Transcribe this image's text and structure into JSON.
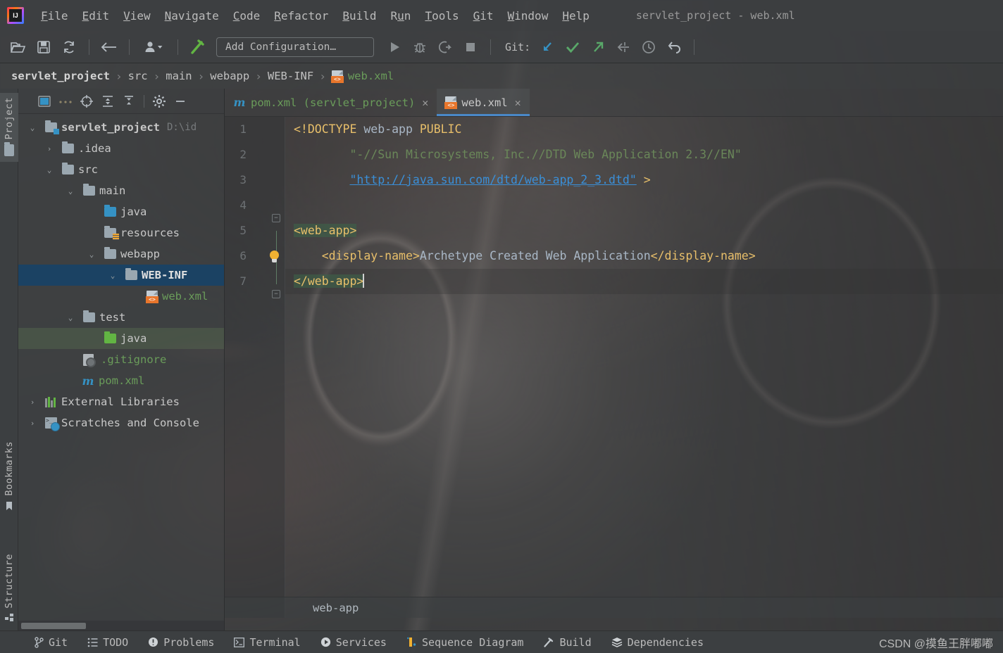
{
  "window": {
    "title": "servlet_project - web.xml",
    "logo_icon": "intellij-idea-logo"
  },
  "menubar": {
    "items": [
      {
        "label": "File",
        "mnemonic": "F",
        "rest": "ile"
      },
      {
        "label": "Edit",
        "mnemonic": "E",
        "rest": "dit"
      },
      {
        "label": "View",
        "mnemonic": "V",
        "rest": "iew"
      },
      {
        "label": "Navigate",
        "mnemonic": "N",
        "rest": "avigate"
      },
      {
        "label": "Code",
        "mnemonic": "C",
        "rest": "ode"
      },
      {
        "label": "Refactor",
        "mnemonic": "R",
        "rest": "efactor"
      },
      {
        "label": "Build",
        "mnemonic": "B",
        "rest": "uild"
      },
      {
        "label": "Run",
        "mnemonic": "R",
        "rest": "un"
      },
      {
        "label": "Tools",
        "mnemonic": "T",
        "rest": "ools"
      },
      {
        "label": "Git",
        "mnemonic": "G",
        "rest": "it"
      },
      {
        "label": "Window",
        "mnemonic": "W",
        "rest": "indow"
      },
      {
        "label": "Help",
        "mnemonic": "H",
        "rest": "elp"
      }
    ]
  },
  "toolbar": {
    "icons": [
      "open-folder-icon",
      "save-all-icon",
      "sync-refresh-icon",
      "back-arrow-icon",
      "user-profile-icon",
      "build-hammer-icon"
    ],
    "run_configuration": "Add Configuration…",
    "run_icon": "run-play-icon",
    "debug_icon": "debug-bug-icon",
    "run_coverage_icon": "run-with-coverage-icon",
    "stop_icon": "stop-square-icon",
    "git_label": "Git:",
    "git_icons": [
      "git-update-project-icon",
      "git-commit-check-icon",
      "git-push-icon",
      "git-rebase-icon",
      "git-history-clock-icon",
      "git-rollback-undo-icon"
    ]
  },
  "breadcrumb": {
    "items": [
      {
        "label": "servlet_project",
        "style": "bold"
      },
      {
        "label": "src",
        "style": "plain"
      },
      {
        "label": "main",
        "style": "plain"
      },
      {
        "label": "webapp",
        "style": "plain"
      },
      {
        "label": "WEB-INF",
        "style": "plain"
      },
      {
        "label": "web.xml",
        "style": "file",
        "icon": "xml-file-icon"
      }
    ],
    "separator": "›"
  },
  "rail": {
    "items": [
      {
        "label": "Project",
        "icon": "project-folder-icon",
        "active": true
      },
      {
        "label": "Bookmarks",
        "icon": "bookmark-flag-icon",
        "active": false
      },
      {
        "label": "Structure",
        "icon": "structure-grid-icon",
        "active": false
      }
    ]
  },
  "project_panel": {
    "toolbar_icons": [
      "select-opened-file-icon",
      "more-options-icon",
      "locate-target-icon",
      "expand-all-icon",
      "collapse-all-icon",
      "settings-gear-icon",
      "hide-minus-icon"
    ],
    "tree": [
      {
        "label": "servlet_project",
        "path": "D:\\id",
        "icon": "module-folder-icon",
        "twist": "⌄",
        "indent": 0,
        "color": "plain",
        "row": "none"
      },
      {
        "label": ".idea",
        "path": "",
        "icon": "folder-icon",
        "twist": "›",
        "indent": 1,
        "color": "plain",
        "row": "none"
      },
      {
        "label": "src",
        "path": "",
        "icon": "folder-icon",
        "twist": "⌄",
        "indent": 1,
        "color": "plain",
        "row": "none"
      },
      {
        "label": "main",
        "path": "",
        "icon": "folder-icon",
        "twist": "⌄",
        "indent": 2,
        "color": "plain",
        "row": "none"
      },
      {
        "label": "java",
        "path": "",
        "icon": "sources-root-folder-icon",
        "twist": "",
        "indent": 3,
        "color": "plain",
        "row": "none"
      },
      {
        "label": "resources",
        "path": "",
        "icon": "resources-root-folder-icon",
        "twist": "",
        "indent": 3,
        "color": "plain",
        "row": "none"
      },
      {
        "label": "webapp",
        "path": "",
        "icon": "folder-icon",
        "twist": "⌄",
        "indent": 3,
        "color": "plain",
        "row": "none"
      },
      {
        "label": "WEB-INF",
        "path": "",
        "icon": "folder-icon",
        "twist": "⌄",
        "indent": 4,
        "color": "plain",
        "row": "selected"
      },
      {
        "label": "web.xml",
        "path": "",
        "icon": "xml-file-icon",
        "twist": "",
        "indent": 5,
        "color": "green",
        "row": "none"
      },
      {
        "label": "test",
        "path": "",
        "icon": "folder-icon",
        "twist": "⌄",
        "indent": 2,
        "color": "plain",
        "row": "none"
      },
      {
        "label": "java",
        "path": "",
        "icon": "test-sources-root-folder-icon",
        "twist": "",
        "indent": 3,
        "color": "plain",
        "row": "highlight"
      },
      {
        "label": ".gitignore",
        "path": "",
        "icon": "gitignore-file-icon",
        "twist": "",
        "indent": 2,
        "color": "green",
        "row": "none"
      },
      {
        "label": "pom.xml",
        "path": "",
        "icon": "maven-pom-icon",
        "twist": "",
        "indent": 2,
        "color": "green",
        "row": "none"
      },
      {
        "label": "External Libraries",
        "path": "",
        "icon": "external-libraries-icon",
        "twist": "›",
        "indent": 0,
        "color": "plain",
        "row": "none"
      },
      {
        "label": "Scratches and Console",
        "path": "",
        "icon": "scratches-console-icon",
        "twist": "›",
        "indent": 0,
        "color": "plain",
        "row": "none"
      }
    ]
  },
  "editor": {
    "tabs": [
      {
        "label": "pom.xml (servlet_project)",
        "icon": "maven-pom-icon",
        "active": false,
        "close": "✕"
      },
      {
        "label": "web.xml",
        "icon": "xml-file-icon",
        "active": true,
        "close": "✕"
      }
    ],
    "line_numbers": [
      "1",
      "2",
      "3",
      "4",
      "5",
      "6",
      "7"
    ],
    "lines": [
      {
        "n": "1",
        "segments": [
          {
            "t": "<!DOCTYPE ",
            "c": "tag"
          },
          {
            "t": "web-app",
            "c": "txt"
          },
          {
            "t": " PUBLIC",
            "c": "tag"
          }
        ]
      },
      {
        "n": "2",
        "segments": [
          {
            "t": "        \"-//Sun Microsystems, Inc.//DTD Web Application 2.3//EN\"",
            "c": "str"
          }
        ]
      },
      {
        "n": "3",
        "segments": [
          {
            "t": "        ",
            "c": "txt"
          },
          {
            "t": "\"http://java.sun.com/dtd/web-app_2_3.dtd\"",
            "c": "url"
          },
          {
            "t": " >",
            "c": "tag"
          }
        ]
      },
      {
        "n": "4",
        "segments": []
      },
      {
        "n": "5",
        "segments": [
          {
            "t": "<web-app>",
            "c": "tag",
            "hl": true
          }
        ]
      },
      {
        "n": "6",
        "segments": [
          {
            "t": "    ",
            "c": "txt"
          },
          {
            "t": "<display-name>",
            "c": "tag"
          },
          {
            "t": "Archetype Created Web Application",
            "c": "txt"
          },
          {
            "t": "</display-name>",
            "c": "tag"
          }
        ]
      },
      {
        "n": "7",
        "segments": [
          {
            "t": "</web-app>",
            "c": "tag",
            "hl": true,
            "caret": true
          }
        ]
      }
    ],
    "footer_breadcrumb": "web-app",
    "bulb_icon": "intention-lightbulb-icon",
    "caret_line": 7
  },
  "statusbar": {
    "items": [
      {
        "label": "Git",
        "icon": "git-branch-icon"
      },
      {
        "label": "TODO",
        "icon": "todo-list-icon"
      },
      {
        "label": "Problems",
        "icon": "problems-exclamation-icon"
      },
      {
        "label": "Terminal",
        "icon": "terminal-icon"
      },
      {
        "label": "Services",
        "icon": "services-play-icon"
      },
      {
        "label": "Sequence Diagram",
        "icon": "sequence-diagram-icon"
      },
      {
        "label": "Build",
        "icon": "build-hammer-icon"
      },
      {
        "label": "Dependencies",
        "icon": "dependencies-layers-icon"
      }
    ],
    "watermark": "CSDN @摸鱼王胖嘟嘟"
  },
  "colors": {
    "accent_blue": "#4a88c7",
    "selection_blue": "#1b4263",
    "tag_orange": "#e8bf6a",
    "string_green": "#6a8759",
    "link_blue": "#3a8fd8",
    "file_green": "#6a9c5a",
    "panel_bg": "#3c3f41"
  }
}
